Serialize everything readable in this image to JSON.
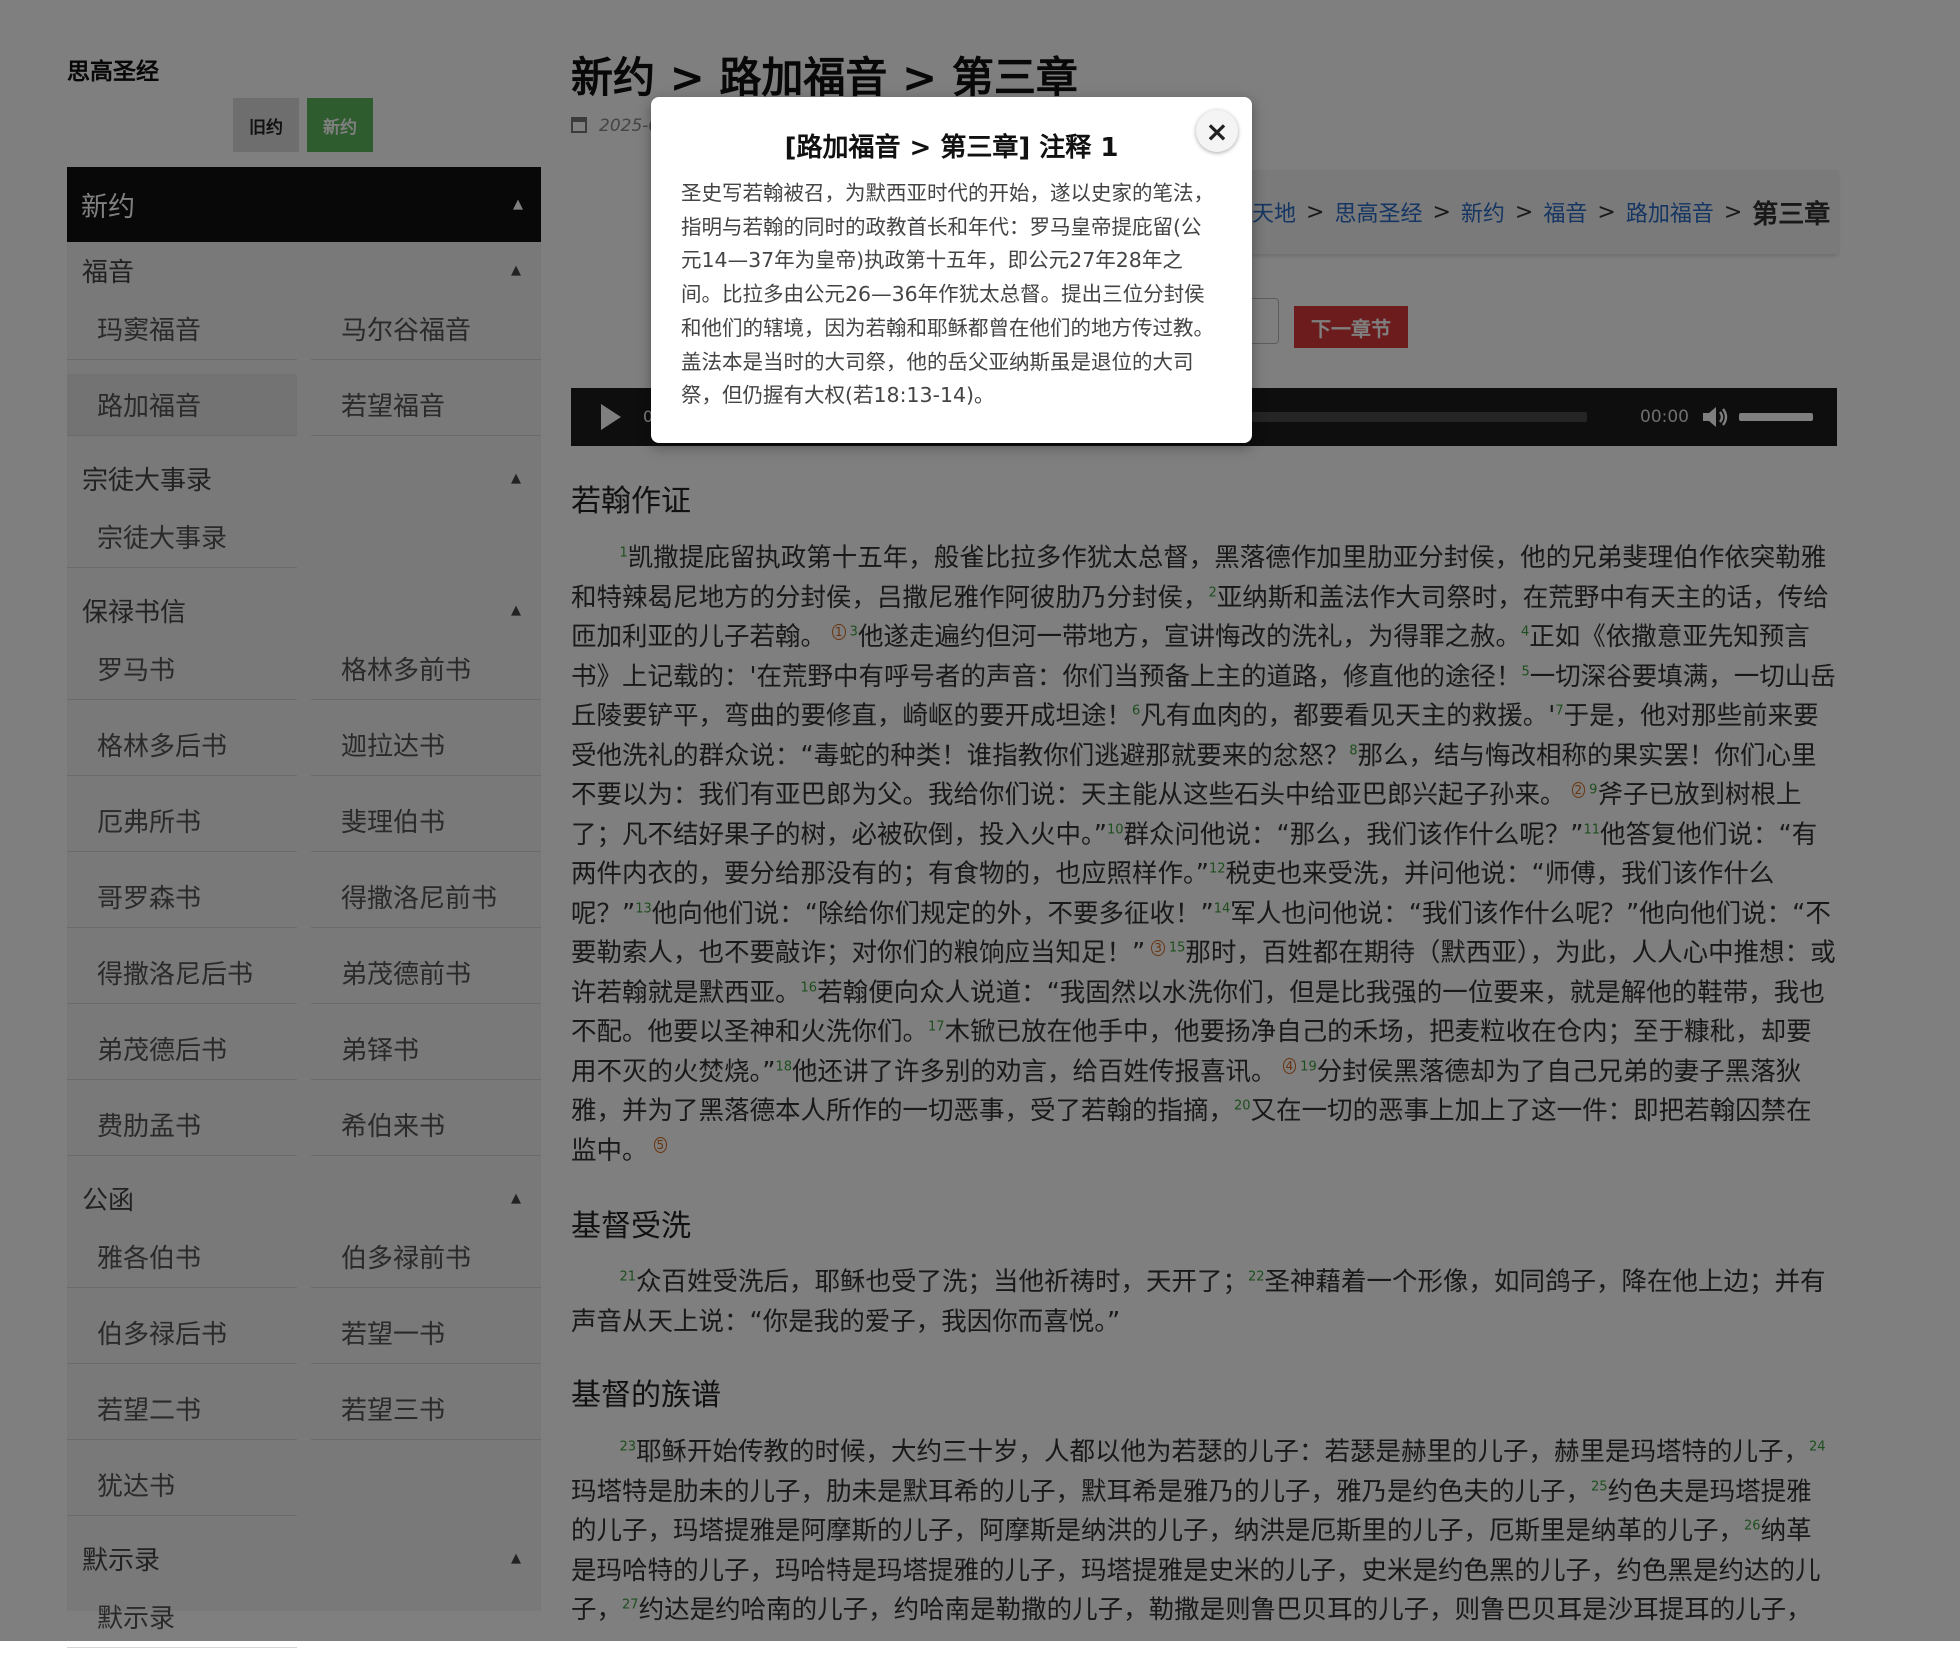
{
  "site": {
    "title": "思高圣经",
    "testament_old": "旧约",
    "testament_new": "新约"
  },
  "sidebar": {
    "header": "新约",
    "groups": [
      {
        "title": "福音",
        "items": [
          "玛窦福音",
          "马尔谷福音",
          "路加福音",
          "若望福音"
        ],
        "active": "路加福音"
      },
      {
        "title": "宗徒大事录",
        "items": [
          "宗徒大事录"
        ]
      },
      {
        "title": "保禄书信",
        "items": [
          "罗马书",
          "格林多前书",
          "格林多后书",
          "迦拉达书",
          "厄弗所书",
          "斐理伯书",
          "哥罗森书",
          "得撒洛尼前书",
          "得撒洛尼后书",
          "弟茂德前书",
          "弟茂德后书",
          "弟铎书",
          "费肋孟书",
          "希伯来书"
        ]
      },
      {
        "title": "公函",
        "items": [
          "雅各伯书",
          "伯多禄前书",
          "伯多禄后书",
          "若望一书",
          "若望二书",
          "若望三书",
          "犹达书"
        ]
      },
      {
        "title": "默示录",
        "items": [
          "默示录"
        ]
      }
    ]
  },
  "main": {
    "title": "新约 > 路加福音 > 第三章",
    "date": "2025-0",
    "breadcrumb": {
      "items": [
        "天地",
        "思高圣经",
        "新约",
        "福音",
        "路加福音"
      ],
      "current": "第三章",
      "separator": ">"
    },
    "next_chapter": "下一章节",
    "audio": {
      "time_start": "0",
      "time_end": "00:00"
    },
    "sections": [
      {
        "title": "若翰作证",
        "text": "<sup>1</sup>凯撒提庇留执政第十五年，般雀比拉多作犹太总督，黑落德作加里肋亚分封侯，他的兄弟斐理伯作依突勒雅和特辣曷尼地方的分封侯，吕撒尼雅作阿彼肋乃分封侯，<sup>2</sup>亚纳斯和盖法作大司祭时，在荒野中有天主的话，传给匝加利亚的儿子若翰。<span class=\"fn\">1</span><sup>3</sup>他遂走遍约但河一带地方，宣讲悔改的洗礼，为得罪之赦。<sup>4</sup>正如《依撒意亚先知预言书》上记载的：'在荒野中有呼号者的声音：你们当预备上主的道路，修直他的途径！<sup>5</sup>一切深谷要填满，一切山岳丘陵要铲平，弯曲的要修直，崎岖的要开成坦途！<sup>6</sup>凡有血肉的，都要看见天主的救援。'<sup>7</sup>于是，他对那些前来要受他洗礼的群众说：“毒蛇的种类！谁指教你们逃避那就要来的忿怒？<sup>8</sup>那么，结与悔改相称的果实罢！你们心里不要以为：我们有亚巴郎为父。我给你们说：天主能从这些石头中给亚巴郎兴起子孙来。<span class=\"fn\">2</span><sup>9</sup>斧子已放到树根上了；凡不结好果子的树，必被砍倒，投入火中。”<sup>10</sup>群众问他说：“那么，我们该作什么呢？”<sup>11</sup>他答复他们说：“有两件内衣的，要分给那没有的；有食物的，也应照样作。”<sup>12</sup>税吏也来受洗，并问他说：“师傅，我们该作什么呢？”<sup>13</sup>他向他们说：“除给你们规定的外，不要多征收！”<sup>14</sup>军人也问他说：“我们该作什么呢？”他向他们说：“不要勒索人，也不要敲诈；对你们的粮饷应当知足！”<span class=\"fn\">3</span><sup>15</sup>那时，百姓都在期待（默西亚），为此，人人心中推想：或许若翰就是默西亚。<sup>16</sup>若翰便向众人说道：“我固然以水洗你们，但是比我强的一位要来，就是解他的鞋带，我也不配。他要以圣神和火洗你们。<sup>17</sup>木锨已放在他手中，他要扬净自己的禾场，把麦粒收在仓内；至于糠秕，却要用不灭的火焚烧。”<sup>18</sup>他还讲了许多别的劝言，给百姓传报喜讯。<span class=\"fn\">4</span><sup>19</sup>分封侯黑落德却为了自己兄弟的妻子黑落狄雅，并为了黑落德本人所作的一切恶事，受了若翰的指摘，<sup>20</sup>又在一切的恶事上加上了这一件：即把若翰囚禁在监中。<span class=\"fn\">5</span>"
      },
      {
        "title": "基督受洗",
        "text": "<sup>21</sup>众百姓受洗后，耶稣也受了洗；当他祈祷时，天开了；<sup>22</sup>圣神藉着一个形像，如同鸽子，降在他上边；并有声音从天上说：“你是我的爱子，我因你而喜悦。”"
      },
      {
        "title": "基督的族谱",
        "text": "<sup>23</sup>耶稣开始传教的时候，大约三十岁，人都以他为若瑟的儿子：若瑟是赫里的儿子，赫里是玛塔特的儿子，<sup>24</sup>玛塔特是肋未的儿子，肋未是默耳希的儿子，默耳希是雅乃的儿子，雅乃是约色夫的儿子，<sup>25</sup>约色夫是玛塔提雅的儿子，玛塔提雅是阿摩斯的儿子，阿摩斯是纳洪的儿子，纳洪是厄斯里的儿子，厄斯里是纳革的儿子，<sup>26</sup>纳革是玛哈特的儿子，玛哈特是玛塔提雅的儿子，玛塔提雅是史米的儿子，史米是约色黑的儿子，约色黑是约达的儿子，<sup>27</sup>约达是约哈南的儿子，约哈南是勒撒的儿子，勒撒是则鲁巴贝耳的儿子，则鲁巴贝耳是沙耳提耳的儿子，"
      }
    ]
  },
  "modal": {
    "title": "[路加福音 > 第三章] 注释 1",
    "body": "圣史写若翰被召，为默西亚时代的开始，遂以史家的笔法，指明与若翰的同时的政教首长和年代：罗马皇帝提庇留(公元14—37年为皇帝)执政第十五年，即公元27年28年之间。比拉多由公元26—36年作犹太总督。提出三位分封侯和他们的辖境，因为若翰和耶稣都曾在他们的地方传过教。盖法本是当时的大司祭，他的岳父亚纳斯虽是退位的大司祭，但仍握有大权(若18:13-14)。",
    "close": "×"
  },
  "colors": {
    "sidebar_header_bg": "#111111",
    "new_testament_btn": "#5cb85c",
    "next_btn": "#d9383a",
    "link": "#2a6bc4",
    "verse_number": "#3a9d3a",
    "footnote": "#d2691e"
  }
}
